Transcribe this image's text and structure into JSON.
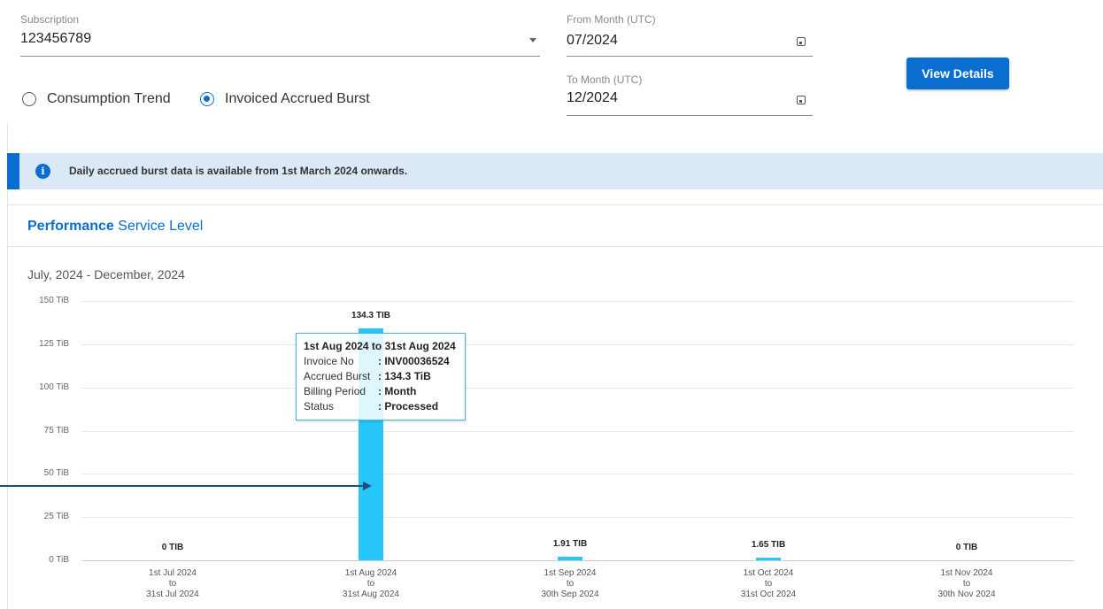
{
  "subscription": {
    "label": "Subscription",
    "value": "123456789"
  },
  "from_month": {
    "label": "From Month (UTC)",
    "value": "07/2024"
  },
  "to_month": {
    "label": "To Month (UTC)",
    "value": "12/2024"
  },
  "view_button": "View Details",
  "radios": [
    {
      "label": "Consumption Trend",
      "selected": false
    },
    {
      "label": "Invoiced Accrued Burst",
      "selected": true
    }
  ],
  "info_text": "Daily accrued burst data is available from 1st March 2024 onwards.",
  "card": {
    "title_bold": "Performance",
    "title_rest": "Service Level"
  },
  "colors": {
    "accent": "#0a6ed1",
    "bar": "#26c6f9",
    "info_bg": "#dbe8f5"
  },
  "chart_data": {
    "type": "bar",
    "title": "July, 2024 - December, 2024",
    "y_ticks": [
      "150 TiB",
      "125 TiB",
      "100 TiB",
      "75 TiB",
      "50 TiB",
      "25 TiB",
      "0 TiB"
    ],
    "ylim": [
      0,
      150
    ],
    "y_unit": "TiB",
    "categories": [
      [
        "1st Jul 2024",
        "to",
        "31st Jul 2024"
      ],
      [
        "1st Aug 2024",
        "to",
        "31st Aug 2024"
      ],
      [
        "1st Sep 2024",
        "to",
        "30th Sep 2024"
      ],
      [
        "1st Oct 2024",
        "to",
        "31st Oct 2024"
      ],
      [
        "1st Nov 2024",
        "to",
        "30th Nov 2024"
      ]
    ],
    "values": [
      0,
      134.3,
      1.91,
      1.65,
      0
    ],
    "data_labels": [
      "0 TIB",
      "134.3 TIB",
      "1.91 TIB",
      "1.65 TIB",
      "0 TIB"
    ],
    "tooltip": {
      "title": "1st Aug 2024 to 31st Aug 2024",
      "rows": [
        {
          "key": "Invoice No",
          "value": ": INV00036524"
        },
        {
          "key": "Accrued Burst",
          "value": ": 134.3 TiB"
        },
        {
          "key": "Billing Period",
          "value": ": Month"
        },
        {
          "key": "Status",
          "value": ": Processed"
        }
      ]
    }
  }
}
